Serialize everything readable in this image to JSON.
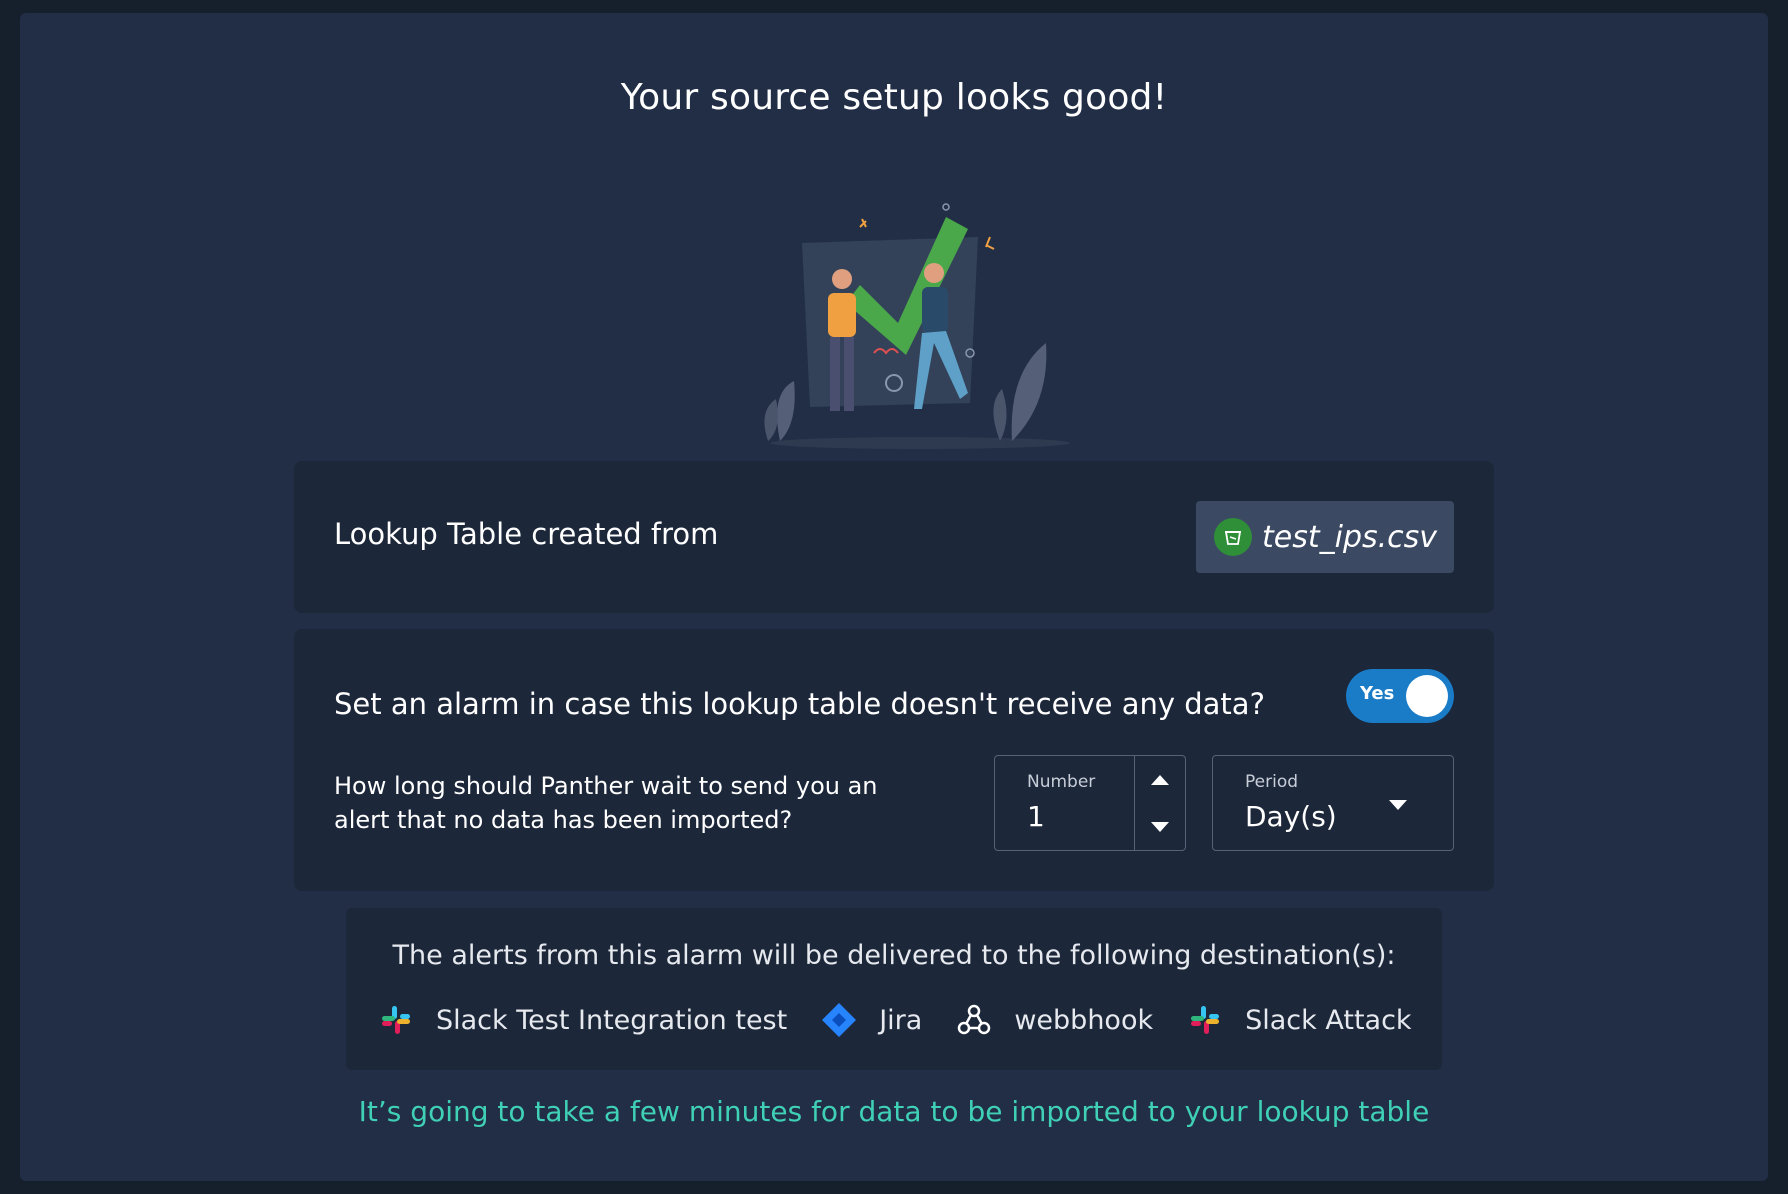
{
  "page": {
    "title": "Your source setup looks good!"
  },
  "lookup_card": {
    "label": "Lookup Table created from",
    "file_name": "test_ips.csv",
    "file_icon": "bucket-icon"
  },
  "alarm_card": {
    "question": "Set an alarm in case this lookup table doesn't receive any data?",
    "toggle_label": "Yes",
    "toggle_on": true,
    "wait_question": "How long should Panther wait to send you an alert that no data has been imported?",
    "number_label": "Number",
    "number_value": "1",
    "period_label": "Period",
    "period_value": "Day(s)"
  },
  "destinations": {
    "title": "The alerts from this alarm will be delivered to the following destination(s):",
    "items": [
      {
        "name": "Slack Test Integration test",
        "icon": "slack-icon"
      },
      {
        "name": "Jira",
        "icon": "jira-icon"
      },
      {
        "name": "webbhook",
        "icon": "webhook-icon"
      },
      {
        "name": "Slack Attack",
        "icon": "slack-icon"
      }
    ]
  },
  "footer": {
    "note": "It’s going to take a few minutes for data to be imported to your lookup table"
  },
  "colors": {
    "background": "#161f2c",
    "panel": "#212e46",
    "card": "#1c273a",
    "toggle": "#1a7bc6",
    "accent_text": "#3fd0b6"
  }
}
